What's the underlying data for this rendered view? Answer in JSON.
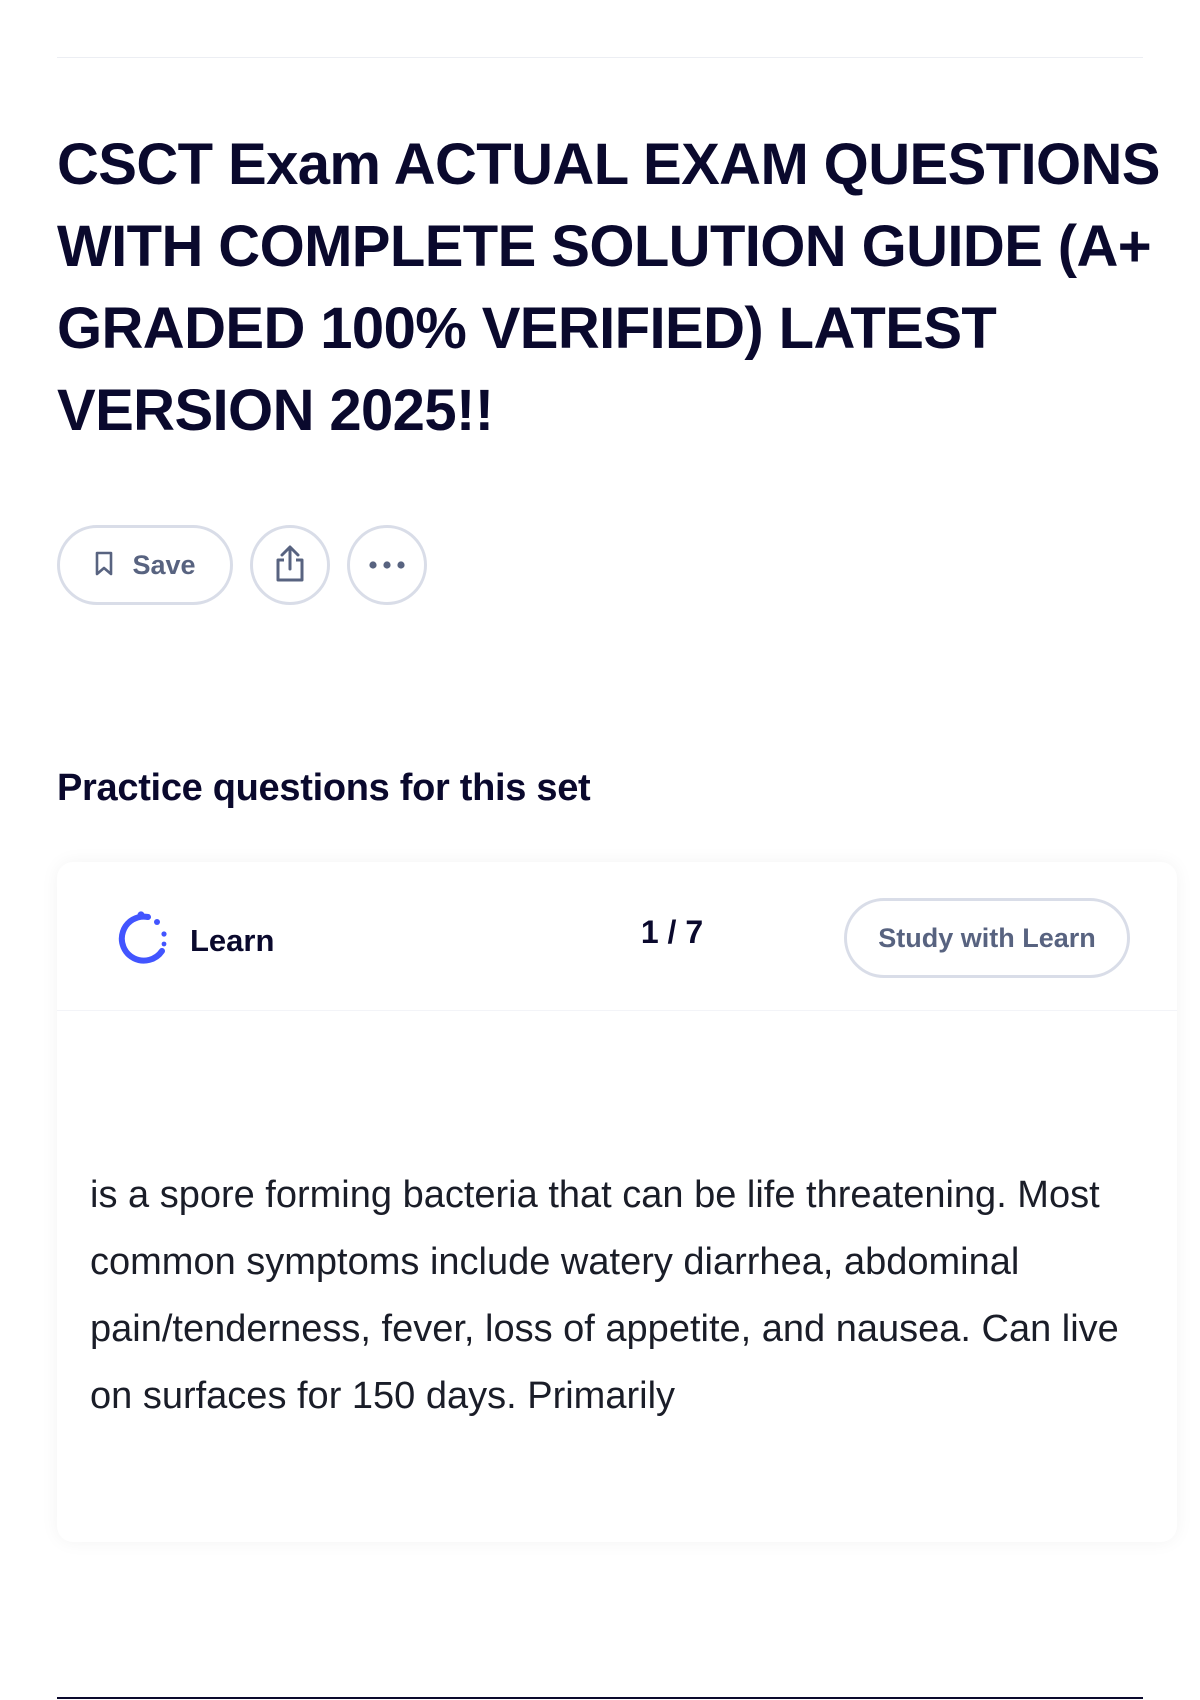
{
  "page": {
    "title": "CSCT Exam ACTUAL EXAM QUESTIONS WITH COMPLETE SOLUTION GUIDE (A+ GRADED 100% VERIFIED) LATEST VERSION 2025!!"
  },
  "actions": {
    "save_label": "Save",
    "save_icon": "bookmark-icon",
    "share_icon": "share-icon",
    "more_icon": "more-dots-icon"
  },
  "practice": {
    "heading": "Practice questions for this set",
    "mode_label": "Learn",
    "mode_icon": "learn-spinner-icon",
    "progress": "1 / 7",
    "study_button_label": "Study with Learn",
    "question_text": "is a spore forming bacteria that can be life threatening. Most common symptoms include watery diarrhea, abdominal pain/tenderness, fever, loss of appetite, and nausea. Can live on surfaces for 150 days. Primarily"
  },
  "colors": {
    "text_primary": "#0a092d",
    "text_secondary": "#586380",
    "border": "#d9dde8",
    "accent": "#4255ff"
  }
}
